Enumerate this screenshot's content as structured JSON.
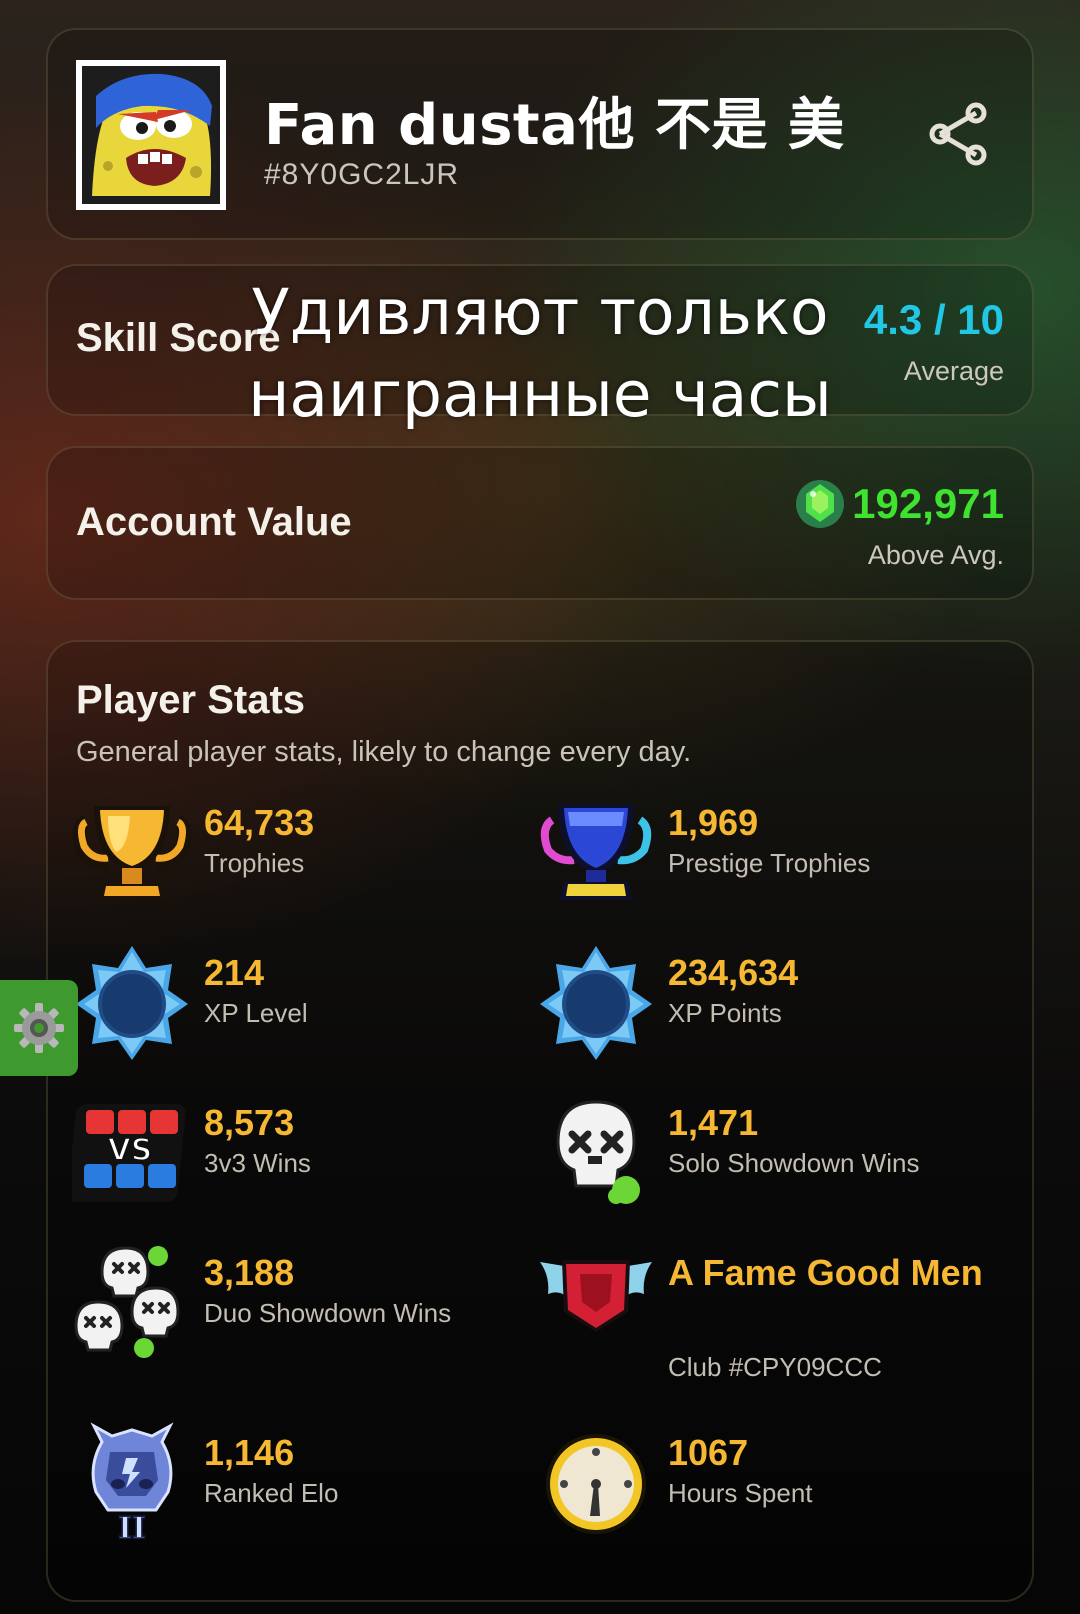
{
  "profile": {
    "name": "Fan dusta他 不是 美",
    "tag": "#8Y0GC2LJR"
  },
  "skill": {
    "label": "Skill Score",
    "value": "4.3 / 10",
    "rating": "Average"
  },
  "overlay": {
    "line1": "Удивляют только",
    "line2": "наигранные часы"
  },
  "account": {
    "label": "Account Value",
    "value": "192,971",
    "rating": "Above Avg."
  },
  "stats": {
    "title": "Player Stats",
    "description": "General player stats, likely to change every day.",
    "items": [
      {
        "value": "64,733",
        "label": "Trophies",
        "icon": "trophy-icon"
      },
      {
        "value": "1,969",
        "label": "Prestige Trophies",
        "icon": "prestige-trophy-icon"
      },
      {
        "value": "214",
        "label": "XP Level",
        "icon": "xp-star-icon"
      },
      {
        "value": "234,634",
        "label": "XP Points",
        "icon": "xp-star-icon"
      },
      {
        "value": "8,573",
        "label": "3v3 Wins",
        "icon": "vs-icon"
      },
      {
        "value": "1,471",
        "label": "Solo Showdown Wins",
        "icon": "skull-icon"
      },
      {
        "value": "3,188",
        "label": "Duo Showdown Wins",
        "icon": "skulls-icon"
      },
      {
        "value": "A Fame Good Men",
        "label": "Club #CPY09CCC",
        "icon": "club-badge-icon"
      },
      {
        "value": "1,146",
        "label": "Ranked Elo",
        "icon": "ranked-mask-icon"
      },
      {
        "value": "1067",
        "label": "Hours Spent",
        "icon": "clock-icon"
      }
    ]
  },
  "colors": {
    "accent_gold": "#f6b733",
    "skill_cyan": "#22c7e6",
    "value_green": "#3fe22e"
  }
}
